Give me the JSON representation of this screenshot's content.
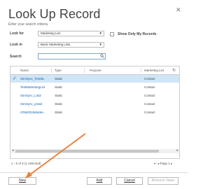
{
  "dialog": {
    "title": "Look Up Record",
    "subtitle": "Enter your search criteria.",
    "close_glyph": "✕"
  },
  "form": {
    "look_for_label": "Look for",
    "look_for_value": "Marketing List",
    "look_in_label": "Look in",
    "look_in_value": "Basic Marketing Lists",
    "search_label": "Search",
    "search_value": "",
    "show_only_my_records": "Show Only My Records",
    "show_only_my_records_checked": false
  },
  "grid": {
    "columns": [
      "Name",
      "Type",
      "Purpose",
      "Marketing List"
    ],
    "rows": [
      {
        "name": "SimSync_TestML",
        "type": "Static",
        "purpose": "",
        "marketing_list": "Contact",
        "selected": true
      },
      {
        "name": "TestMarketingList",
        "type": "Static",
        "purpose": "",
        "marketing_list": "Contact",
        "selected": false
      },
      {
        "name": "SimSync_List2",
        "type": "Static",
        "purpose": "",
        "marketing_list": "Contact",
        "selected": false
      },
      {
        "name": "SimSync_prasit",
        "type": "Static",
        "purpose": "",
        "marketing_list": "Contact",
        "selected": false
      },
      {
        "name": "CRM2015Marke...",
        "type": "Static",
        "purpose": "",
        "marketing_list": "Contact",
        "selected": false
      }
    ]
  },
  "status": {
    "record_count": "1 - 5 of 5 (1 selected)",
    "page_label": "Page 1"
  },
  "buttons": {
    "new": "New",
    "add": "Add",
    "cancel": "Cancel",
    "remove_value": "Remove Value"
  },
  "annotation": {
    "arrow_color": "#e8823a"
  },
  "colors": {
    "link": "#1160b7",
    "selected_row": "#cfe6f7"
  }
}
